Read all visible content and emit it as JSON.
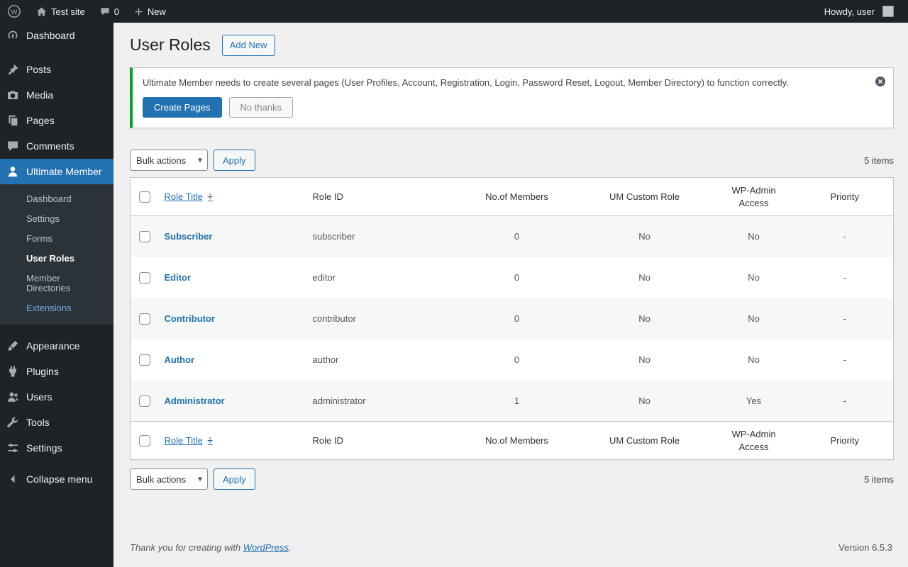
{
  "admin_bar": {
    "site_name": "Test site",
    "comments_count": "0",
    "new_label": "New",
    "howdy": "Howdy, user"
  },
  "sidebar": {
    "items": [
      {
        "label": "Dashboard",
        "icon": "dashboard-icon"
      },
      {
        "label": "Posts",
        "icon": "pin-icon"
      },
      {
        "label": "Media",
        "icon": "camera-icon"
      },
      {
        "label": "Pages",
        "icon": "pages-icon"
      },
      {
        "label": "Comments",
        "icon": "comment-icon"
      },
      {
        "label": "Ultimate Member",
        "icon": "user-icon",
        "active": true
      },
      {
        "label": "Appearance",
        "icon": "brush-icon"
      },
      {
        "label": "Plugins",
        "icon": "plug-icon"
      },
      {
        "label": "Users",
        "icon": "users-icon"
      },
      {
        "label": "Tools",
        "icon": "wrench-icon"
      },
      {
        "label": "Settings",
        "icon": "sliders-icon"
      },
      {
        "label": "Collapse menu",
        "icon": "collapse-icon"
      }
    ],
    "um_submenu": [
      {
        "label": "Dashboard"
      },
      {
        "label": "Settings"
      },
      {
        "label": "Forms"
      },
      {
        "label": "User Roles",
        "current": true
      },
      {
        "label": "Member Directories"
      },
      {
        "label": "Extensions"
      }
    ]
  },
  "page": {
    "title": "User Roles",
    "add_new_label": "Add New"
  },
  "notice": {
    "message": "Ultimate Member needs to create several pages (User Profiles, Account, Registration, Login, Password Reset, Logout, Member Directory) to function correctly.",
    "create_pages_label": "Create Pages",
    "no_thanks_label": "No thanks",
    "accent_color": "#00a32a"
  },
  "toolbar": {
    "bulk_actions_label": "Bulk actions",
    "apply_label": "Apply",
    "items_count": "5 items"
  },
  "table": {
    "headers": {
      "role_title": "Role Title",
      "role_id": "Role ID",
      "members": "No.of Members",
      "custom_role": "UM Custom Role",
      "wp_admin_access": "WP-Admin Access",
      "priority": "Priority"
    },
    "rows": [
      {
        "title": "Subscriber",
        "role_id": "subscriber",
        "members": "0",
        "custom_role": "No",
        "wp_admin_access": "No",
        "priority": "-"
      },
      {
        "title": "Editor",
        "role_id": "editor",
        "members": "0",
        "custom_role": "No",
        "wp_admin_access": "No",
        "priority": "-"
      },
      {
        "title": "Contributor",
        "role_id": "contributor",
        "members": "0",
        "custom_role": "No",
        "wp_admin_access": "No",
        "priority": "-"
      },
      {
        "title": "Author",
        "role_id": "author",
        "members": "0",
        "custom_role": "No",
        "wp_admin_access": "No",
        "priority": "-"
      },
      {
        "title": "Administrator",
        "role_id": "administrator",
        "members": "1",
        "custom_role": "No",
        "wp_admin_access": "Yes",
        "priority": "-"
      }
    ]
  },
  "footer": {
    "thanks_prefix": "Thank you for creating with",
    "wordpress_link": "WordPress",
    "thanks_suffix": ".",
    "version": "Version 6.5.3"
  },
  "colors": {
    "accent_blue": "#2271b1",
    "admin_bar_bg": "#1d2327",
    "notice_green": "#00a32a",
    "content_bg": "#f0f0f1"
  }
}
